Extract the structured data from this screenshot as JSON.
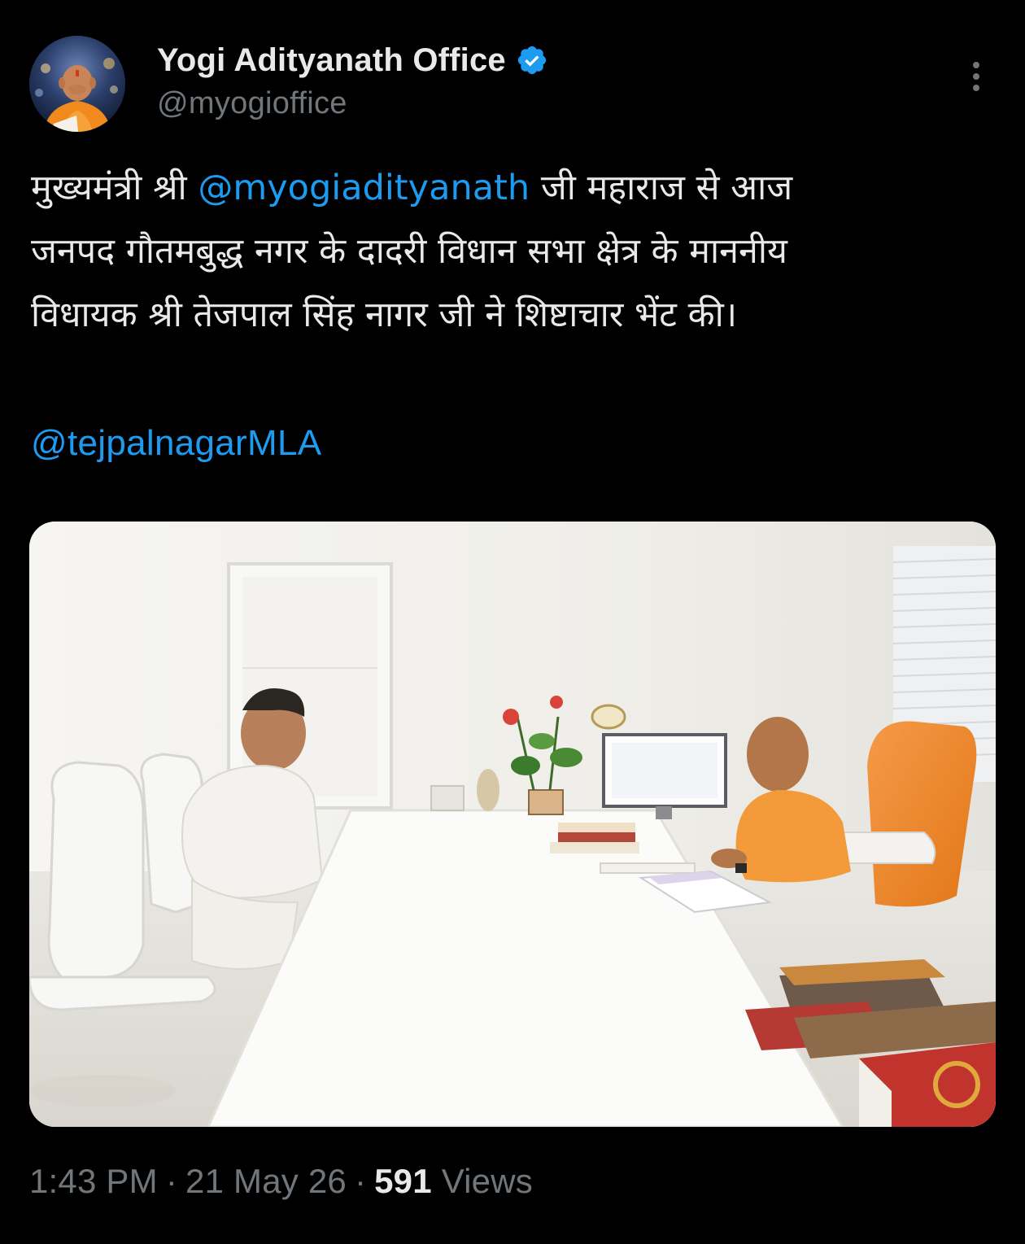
{
  "author": {
    "display_name": "Yogi Adityanath Office",
    "handle": "@myogioffice",
    "verified": true,
    "avatar_icon": "profile-photo"
  },
  "tweet": {
    "text_parts": {
      "p1": "मुख्यमंत्री श्री ",
      "mention1": "@myogiadityanath",
      "p2": " जी महाराज से आज",
      "line2": "जनपद गौतमबुद्ध नगर के दादरी विधान सभा क्षेत्र के माननीय",
      "line3": "विधायक श्री तेजपाल सिंह नागर जी ने शिष्टाचार भेंट की।"
    },
    "mention2": "@tejpalnagarMLA"
  },
  "meta": {
    "time": "1:43 PM",
    "date": "21 May 26",
    "views_count": "591",
    "views_label": "Views",
    "separator": "·"
  },
  "colors": {
    "background": "#000000",
    "text": "#e7e9ea",
    "secondary": "#71767b",
    "link": "#1d9bf0",
    "verified": "#1d9bf0"
  },
  "icons": {
    "more": "more-vertical-icon",
    "verified": "verified-badge-icon"
  }
}
